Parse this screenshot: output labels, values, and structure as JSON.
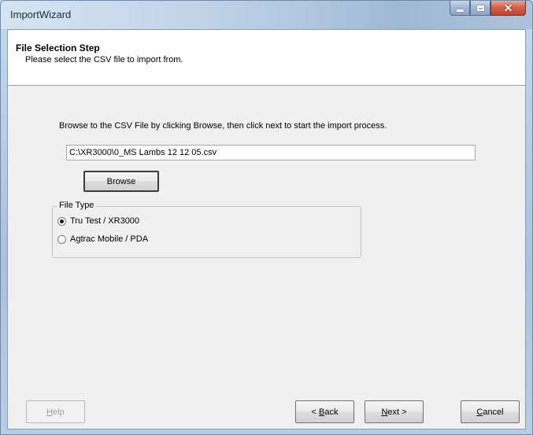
{
  "window": {
    "title": "ImportWizard"
  },
  "header": {
    "title": "File Selection Step",
    "subtitle": "Please select the CSV  file to import from."
  },
  "body": {
    "instructions": "Browse to the CSV File by clicking Browse, then click next to start the import process.",
    "file_path": "C:\\XR3000\\0_MS Lambs 12 12 05.csv",
    "browse_label": "Browse"
  },
  "file_type": {
    "group_label": "File Type",
    "options": [
      {
        "label": "Tru Test / XR3000",
        "selected": true
      },
      {
        "label": "Agtrac Mobile / PDA",
        "selected": false
      }
    ]
  },
  "footer": {
    "help": {
      "mnemonic": "H",
      "rest": "elp",
      "enabled": false
    },
    "back": {
      "prefix": "< ",
      "mnemonic": "B",
      "rest": "ack"
    },
    "next": {
      "mnemonic": "N",
      "rest": "ext >"
    },
    "cancel": {
      "mnemonic": "C",
      "rest": "ancel"
    }
  },
  "colors": {
    "titlebar": "#c5d7ea",
    "client_bg": "#f0f0f0",
    "close_button": "#d4624c"
  }
}
